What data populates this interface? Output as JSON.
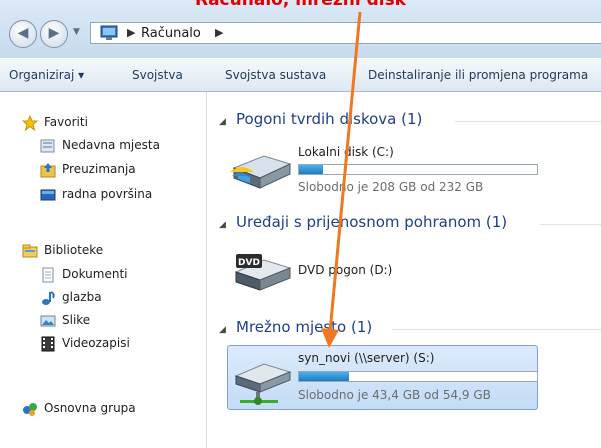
{
  "caption": "Računalo, mrežni disk",
  "colors": {
    "accent": "#1e3f8a",
    "annotation_arrow": "#f07820",
    "caption_text": "#e00000",
    "bar_fill": "#2a8fd6"
  },
  "titlebar": {
    "back_icon": "back-arrow-icon",
    "forward_icon": "forward-arrow-icon",
    "address": {
      "computer_icon": "computer-icon",
      "crumbs": [
        "Računalo"
      ]
    }
  },
  "toolbar": {
    "items": [
      "Organiziraj ▾",
      "Svojstva",
      "Svojstva sustava",
      "Deinstaliranje ili promjena programa"
    ]
  },
  "sidebar": {
    "favorites": {
      "label": "Favoriti",
      "icon": "star-icon",
      "items": [
        {
          "label": "Nedavna mjesta",
          "icon": "recent-places-icon"
        },
        {
          "label": "Preuzimanja",
          "icon": "downloads-icon"
        },
        {
          "label": "radna površina",
          "icon": "desktop-icon"
        }
      ]
    },
    "libraries": {
      "label": "Biblioteke",
      "icon": "library-icon",
      "items": [
        {
          "label": "Dokumenti",
          "icon": "documents-icon"
        },
        {
          "label": "glazba",
          "icon": "music-icon"
        },
        {
          "label": "Slike",
          "icon": "pictures-icon"
        },
        {
          "label": "Videozapisi",
          "icon": "videos-icon"
        }
      ]
    },
    "homegroup": {
      "label": "Osnovna grupa",
      "icon": "homegroup-icon"
    }
  },
  "content": {
    "groups": [
      {
        "title": "Pogoni tvrdih diskova (1)",
        "drive": {
          "name": "Lokalni disk (C:)",
          "free_text": "Slobodno je 208 GB od 232 GB",
          "used_fraction": 0.1,
          "icon": "hard-drive-icon"
        }
      },
      {
        "title": "Uređaji s prijenosnom pohranom (1)",
        "drive": {
          "name": "DVD pogon (D:)",
          "icon": "dvd-drive-icon",
          "icon_label": "DVD"
        }
      },
      {
        "title": "Mrežno mjesto (1)",
        "drive": {
          "name": "syn_novi (\\\\server) (S:)",
          "free_text": "Slobodno je 43,4 GB od 54,9 GB",
          "used_fraction": 0.21,
          "icon": "network-drive-icon"
        }
      }
    ]
  }
}
